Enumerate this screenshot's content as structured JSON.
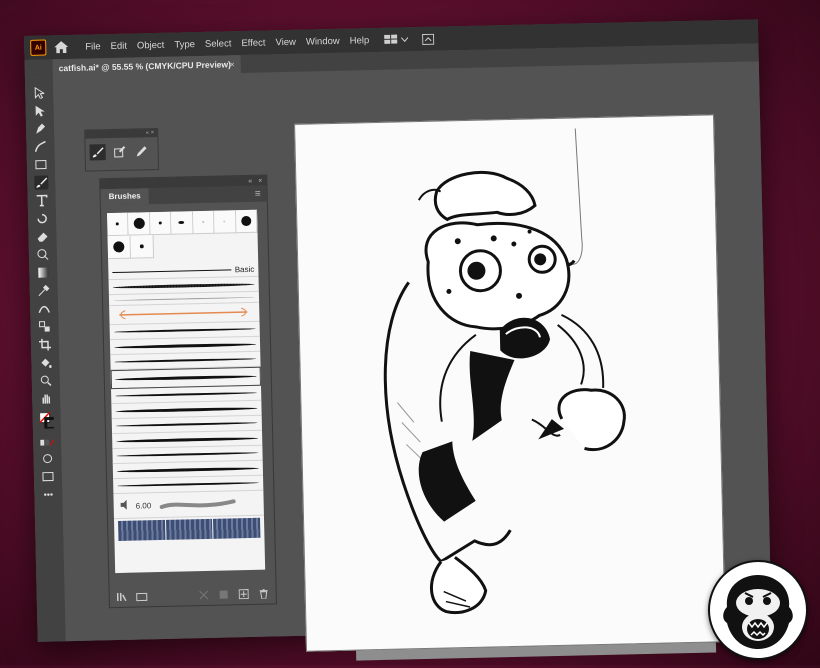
{
  "app": {
    "logo_text": "Ai"
  },
  "menu": {
    "items": [
      "File",
      "Edit",
      "Object",
      "Type",
      "Select",
      "Effect",
      "View",
      "Window",
      "Help"
    ]
  },
  "document": {
    "tab_title": "catfish.ai* @ 55.55 % (CMYK/CPU Preview)",
    "close_label": "×"
  },
  "tools": {
    "names": [
      "selection-tool-icon",
      "direct-selection-tool-icon",
      "pen-tool-icon",
      "curvature-tool-icon",
      "rectangle-tool-icon",
      "paintbrush-tool-icon",
      "type-tool-icon",
      "rotate-tool-icon",
      "eraser-tool-icon",
      "shape-builder-tool-icon",
      "gradient-tool-icon",
      "eyedropper-tool-icon",
      "width-tool-icon",
      "blend-tool-icon",
      "crop-tool-icon",
      "live-paint-tool-icon",
      "zoom-tool-icon",
      "hand-tool-icon"
    ],
    "more_label": "•••"
  },
  "brushes_panel": {
    "tab_label": "Brushes",
    "basic_label": "Basic",
    "size_value": "6.00"
  },
  "colors": {
    "background": "#6a1234",
    "app_bg": "#535353",
    "menubar_bg": "#323232",
    "panel_bg": "#535353",
    "accent": "#ff9a00"
  }
}
